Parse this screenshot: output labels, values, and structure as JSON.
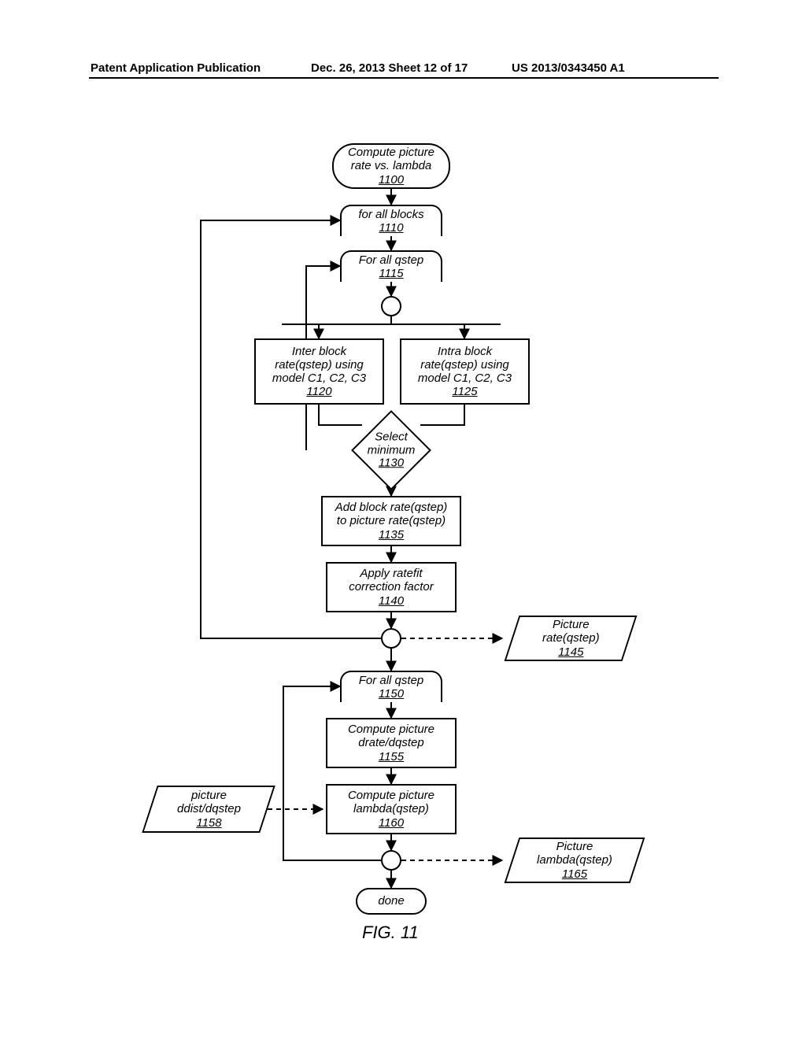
{
  "header": {
    "left": "Patent Application Publication",
    "mid": "Dec. 26, 2013  Sheet 12 of 17",
    "right": "US 2013/0343450 A1"
  },
  "figure_caption": "FIG. 11",
  "nodes": {
    "n1100": {
      "text": "Compute picture\nrate vs. lambda",
      "ref": "1100"
    },
    "n1110": {
      "text": "for all blocks",
      "ref": "1110"
    },
    "n1115": {
      "text": "For all qstep",
      "ref": "1115"
    },
    "n1120": {
      "text": "Inter block\nrate(qstep) using\nmodel C1, C2, C3",
      "ref": "1120"
    },
    "n1125": {
      "text": "Intra block\nrate(qstep) using\nmodel C1, C2, C3",
      "ref": "1125"
    },
    "n1130": {
      "text": "Select\nminimum",
      "ref": "1130"
    },
    "n1135": {
      "text": "Add block rate(qstep)\nto picture rate(qstep)",
      "ref": "1135"
    },
    "n1140": {
      "text": "Apply ratefit\ncorrection factor",
      "ref": "1140"
    },
    "n1145": {
      "text": "Picture\nrate(qstep)",
      "ref": "1145"
    },
    "n1150": {
      "text": "For all qstep",
      "ref": "1150"
    },
    "n1155": {
      "text": "Compute picture\ndrate/dqstep",
      "ref": "1155"
    },
    "n1158": {
      "text": "picture\nddist/dqstep",
      "ref": "1158"
    },
    "n1160": {
      "text": "Compute picture\nlambda(qstep)",
      "ref": "1160"
    },
    "n1165": {
      "text": "Picture\nlambda(qstep)",
      "ref": "1165"
    },
    "done": {
      "text": "done"
    }
  }
}
